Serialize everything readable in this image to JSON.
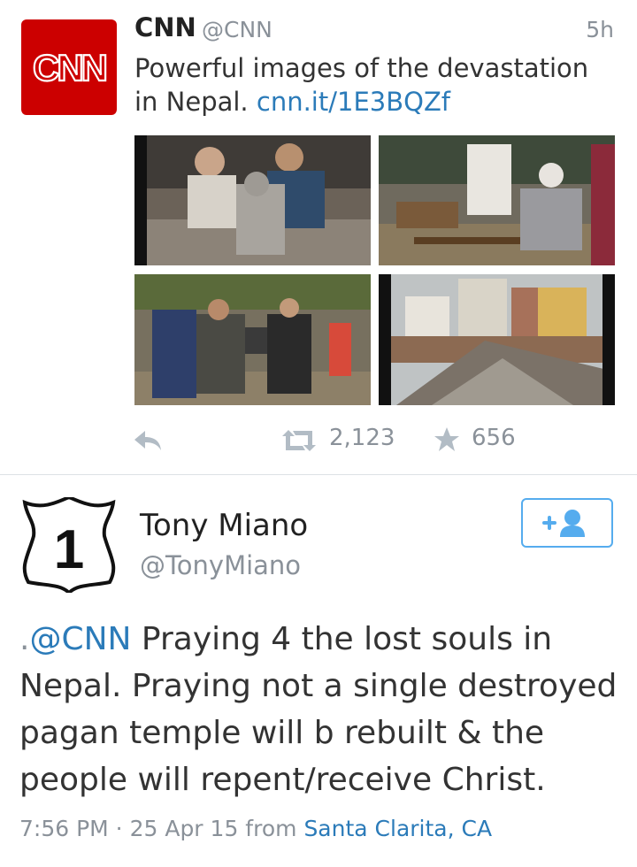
{
  "tweet1": {
    "author_name": "CNN",
    "author_handle": "@CNN",
    "time": "5h",
    "text": "Powerful images of the devastation in Nepal.",
    "link": "cnn.it/1E3BQZf",
    "retweets": "2,123",
    "favorites": "656",
    "avatar_logo": "CNN",
    "brand_color": "#cc0000"
  },
  "tweet2": {
    "author_name": "Tony Miano",
    "author_handle": "@TonyMiano",
    "avatar_label": "1",
    "text_prefix": ".",
    "mention": "@CNN",
    "text": " Praying 4 the lost souls in Nepal. Praying not a single destroyed pagan temple will b rebuilt & the people will repent/receive Christ.",
    "time": "7:56 PM",
    "separator": " · ",
    "date": "25 Apr 15",
    "from_label": " from ",
    "location": "Santa Clarita, CA"
  },
  "colors": {
    "link": "#2b7bb9",
    "muted": "#8a9199",
    "follow_border": "#55acee",
    "divider": "#dde1e5"
  },
  "icons": [
    "reply-icon",
    "retweet-icon",
    "favorite-icon",
    "follow-icon"
  ]
}
